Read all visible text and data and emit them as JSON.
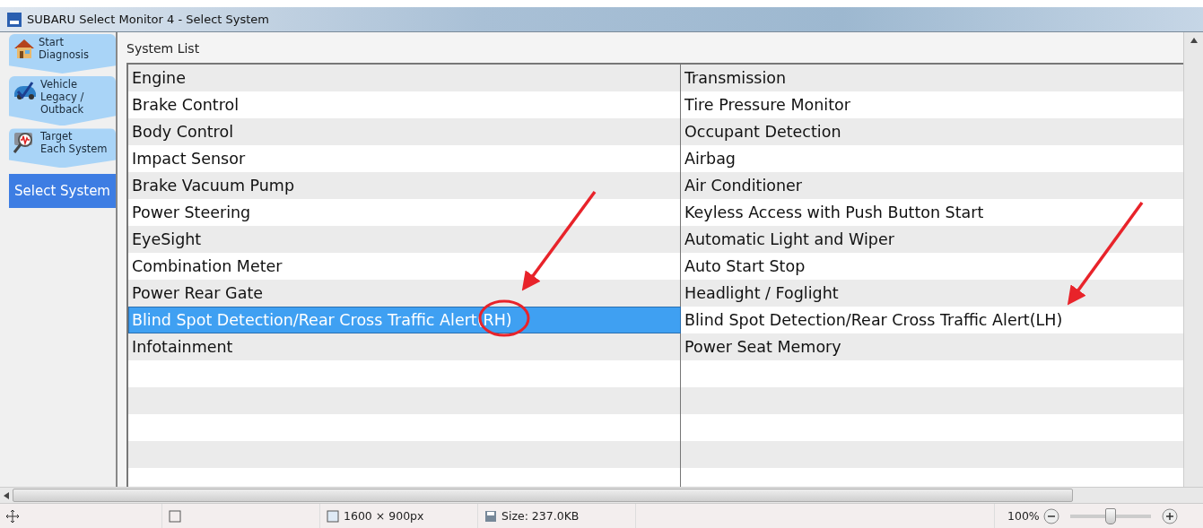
{
  "window": {
    "title": "SUBARU Select Monitor 4 - Select System"
  },
  "sidebar": {
    "items": [
      {
        "label": "Start\nDiagnosis",
        "selected": false
      },
      {
        "label": "Vehicle\nLegacy /\nOutback",
        "selected": false
      },
      {
        "label": "Target\nEach System",
        "selected": false
      },
      {
        "label": "Select System",
        "selected": true
      }
    ]
  },
  "system_list": {
    "title": "System List",
    "rows": [
      [
        {
          "label": "Engine",
          "selected": false
        },
        {
          "label": "Transmission",
          "selected": false
        }
      ],
      [
        {
          "label": "Brake Control",
          "selected": false
        },
        {
          "label": "Tire Pressure Monitor",
          "selected": false
        }
      ],
      [
        {
          "label": "Body Control",
          "selected": false
        },
        {
          "label": "Occupant Detection",
          "selected": false
        }
      ],
      [
        {
          "label": "Impact Sensor",
          "selected": false
        },
        {
          "label": "Airbag",
          "selected": false
        }
      ],
      [
        {
          "label": "Brake Vacuum Pump",
          "selected": false
        },
        {
          "label": "Air Conditioner",
          "selected": false
        }
      ],
      [
        {
          "label": "Power Steering",
          "selected": false
        },
        {
          "label": "Keyless Access with Push Button Start",
          "selected": false
        }
      ],
      [
        {
          "label": "EyeSight",
          "selected": false
        },
        {
          "label": "Automatic Light and Wiper",
          "selected": false
        }
      ],
      [
        {
          "label": "Combination Meter",
          "selected": false
        },
        {
          "label": "Auto Start Stop",
          "selected": false
        }
      ],
      [
        {
          "label": "Power Rear Gate",
          "selected": false
        },
        {
          "label": "Headlight / Foglight",
          "selected": false
        }
      ],
      [
        {
          "label": "Blind Spot Detection/Rear Cross Traffic Alert(RH)",
          "selected": true
        },
        {
          "label": "Blind Spot Detection/Rear Cross Traffic Alert(LH)",
          "selected": false
        }
      ],
      [
        {
          "label": "Infotainment",
          "selected": false
        },
        {
          "label": "Power Seat Memory",
          "selected": false
        }
      ]
    ]
  },
  "status_bar": {
    "dimensions": "1600 × 900px",
    "size": "Size: 237.0KB",
    "zoom": "100%",
    "zoom_slider": {
      "level": 0.5
    }
  }
}
